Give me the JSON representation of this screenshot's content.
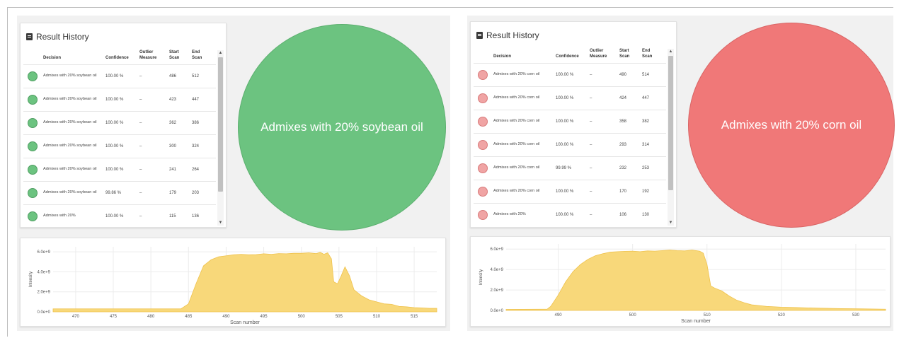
{
  "panels": [
    {
      "id": "left",
      "card_title": "Result History",
      "columns": [
        "Decision",
        "Confidence",
        "Outlier\nMeasure",
        "Start\nScan",
        "End\nScan"
      ],
      "rows": [
        {
          "decision": "Admixes with 20% soybean oil",
          "confidence": "100.00 %",
          "outlier": "–",
          "start": "486",
          "end": "512"
        },
        {
          "decision": "Admixes with 20% soybean oil",
          "confidence": "100.00 %",
          "outlier": "–",
          "start": "423",
          "end": "447"
        },
        {
          "decision": "Admixes with 20% soybean oil",
          "confidence": "100.00 %",
          "outlier": "–",
          "start": "362",
          "end": "386"
        },
        {
          "decision": "Admixes with 20% soybean oil",
          "confidence": "100.00 %",
          "outlier": "–",
          "start": "300",
          "end": "324"
        },
        {
          "decision": "Admixes with 20% soybean oil",
          "confidence": "100.00 %",
          "outlier": "–",
          "start": "241",
          "end": "264"
        },
        {
          "decision": "Admixes with 20% soybean oil",
          "confidence": "99.86 %",
          "outlier": "–",
          "start": "179",
          "end": "203"
        },
        {
          "decision": "Admixes with 20%",
          "confidence": "100.00 %",
          "outlier": "–",
          "start": "115",
          "end": "136"
        }
      ],
      "dot_color": "#6cc380",
      "dot_border": "#4f9e62",
      "result_label": "Admixes with 20% soybean oil",
      "result_color": "#6cc380",
      "result_border": "#5cb06f",
      "chart": {
        "ylabel": "Intensity",
        "xlabel": "Scan number",
        "y_ticks": [
          "0.0e+0",
          "2.0e+9",
          "4.0e+9",
          "6.0e+9"
        ],
        "x_ticks": [
          "470",
          "475",
          "480",
          "485",
          "490",
          "495",
          "500",
          "505",
          "510",
          "515"
        ]
      }
    },
    {
      "id": "right",
      "card_title": "Result History",
      "columns": [
        "Decision",
        "Confidence",
        "Outlier\nMeasure",
        "Start\nScan",
        "End\nScan"
      ],
      "rows": [
        {
          "decision": "Admixes with 20% corn oil",
          "confidence": "100.00 %",
          "outlier": "–",
          "start": "490",
          "end": "514"
        },
        {
          "decision": "Admixes with 20% corn oil",
          "confidence": "100.00 %",
          "outlier": "–",
          "start": "424",
          "end": "447"
        },
        {
          "decision": "Admixes with 20% corn oil",
          "confidence": "100.00 %",
          "outlier": "–",
          "start": "358",
          "end": "382"
        },
        {
          "decision": "Admixes with 20% corn oil",
          "confidence": "100.00 %",
          "outlier": "–",
          "start": "293",
          "end": "314"
        },
        {
          "decision": "Admixes with 20% corn oil",
          "confidence": "99.99 %",
          "outlier": "–",
          "start": "232",
          "end": "253"
        },
        {
          "decision": "Admixes with 20% corn oil",
          "confidence": "100.00 %",
          "outlier": "–",
          "start": "170",
          "end": "192"
        },
        {
          "decision": "Admixes with 20%",
          "confidence": "100.00 %",
          "outlier": "–",
          "start": "106",
          "end": "130"
        }
      ],
      "dot_color": "#f0a4a4",
      "dot_border": "#d87b7b",
      "result_label": "Admixes with 20% corn oil",
      "result_color": "#f07878",
      "result_border": "#d96464",
      "chart": {
        "ylabel": "Intensity",
        "xlabel": "Scan number",
        "y_ticks": [
          "0.0e+0",
          "2.0e+9",
          "4.0e+9",
          "6.0e+9"
        ],
        "x_ticks": [
          "490",
          "500",
          "510",
          "520",
          "530"
        ]
      }
    }
  ],
  "chart_data": [
    {
      "type": "area",
      "title": "",
      "xlabel": "Scan number",
      "ylabel": "Intensity",
      "xlim": [
        467,
        518
      ],
      "ylim": [
        0,
        6500000000.0
      ],
      "grid": true,
      "fill_color": "#f8d87a",
      "line_color": "#efc24d",
      "x": [
        467,
        484,
        485,
        486,
        487,
        488,
        489,
        490,
        491,
        492,
        493,
        494,
        495,
        496,
        497,
        498,
        499,
        500,
        501,
        502,
        502.5,
        503,
        503.5,
        504,
        504.3,
        504.8,
        505.3,
        505.8,
        506.4,
        507,
        508,
        509,
        510,
        511,
        512,
        513,
        514,
        515,
        516,
        517,
        518
      ],
      "y": [
        300000000.0,
        300000000.0,
        800000000.0,
        2800000000.0,
        4600000000.0,
        5200000000.0,
        5500000000.0,
        5600000000.0,
        5700000000.0,
        5750000000.0,
        5700000000.0,
        5720000000.0,
        5800000000.0,
        5750000000.0,
        5820000000.0,
        5800000000.0,
        5850000000.0,
        5850000000.0,
        5900000000.0,
        5820000000.0,
        5950000000.0,
        5750000000.0,
        5900000000.0,
        5300000000.0,
        3000000000.0,
        2800000000.0,
        3600000000.0,
        4500000000.0,
        3600000000.0,
        2200000000.0,
        1600000000.0,
        1200000000.0,
        1000000000.0,
        800000000.0,
        750000000.0,
        550000000.0,
        500000000.0,
        420000000.0,
        400000000.0,
        350000000.0,
        350000000.0
      ]
    },
    {
      "type": "area",
      "title": "",
      "xlabel": "Scan number",
      "ylabel": "Intensity",
      "xlim": [
        483,
        534
      ],
      "ylim": [
        0,
        6500000000.0
      ],
      "grid": true,
      "fill_color": "#f8d87a",
      "line_color": "#efc24d",
      "x": [
        483,
        488.5,
        489,
        490,
        491,
        492,
        493,
        494,
        495,
        496,
        497,
        498,
        499,
        500,
        501,
        502,
        503,
        504,
        505,
        506,
        507,
        508,
        509,
        509.5,
        510,
        510.5,
        511,
        512,
        513,
        514,
        515,
        516,
        518,
        520,
        522,
        525,
        528,
        531,
        534
      ],
      "y": [
        100000000.0,
        120000000.0,
        400000000.0,
        1500000000.0,
        2800000000.0,
        3800000000.0,
        4500000000.0,
        5000000000.0,
        5350000000.0,
        5550000000.0,
        5700000000.0,
        5750000000.0,
        5780000000.0,
        5800000000.0,
        5750000000.0,
        5820000000.0,
        5800000000.0,
        5850000000.0,
        5900000000.0,
        5850000000.0,
        5820000000.0,
        5900000000.0,
        5800000000.0,
        5600000000.0,
        4500000000.0,
        2400000000.0,
        2200000000.0,
        1900000000.0,
        1400000000.0,
        1000000000.0,
        750000000.0,
        550000000.0,
        400000000.0,
        320000000.0,
        280000000.0,
        220000000.0,
        180000000.0,
        150000000.0,
        120000000.0
      ]
    }
  ]
}
